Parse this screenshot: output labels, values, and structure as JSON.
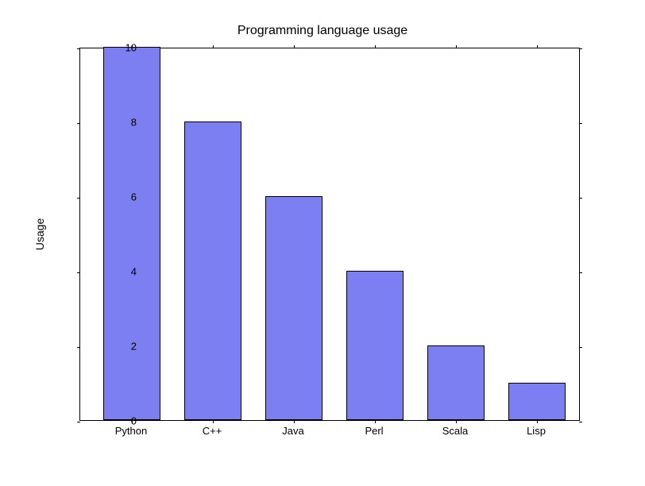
{
  "chart_data": {
    "type": "bar",
    "title": "Programming language usage",
    "xlabel": "",
    "ylabel": "Usage",
    "categories": [
      "Python",
      "C++",
      "Java",
      "Perl",
      "Scala",
      "Lisp"
    ],
    "values": [
      10,
      8,
      6,
      4,
      2,
      1
    ],
    "ylim": [
      0,
      10
    ],
    "yticks": [
      0,
      2,
      4,
      6,
      8,
      10
    ]
  }
}
